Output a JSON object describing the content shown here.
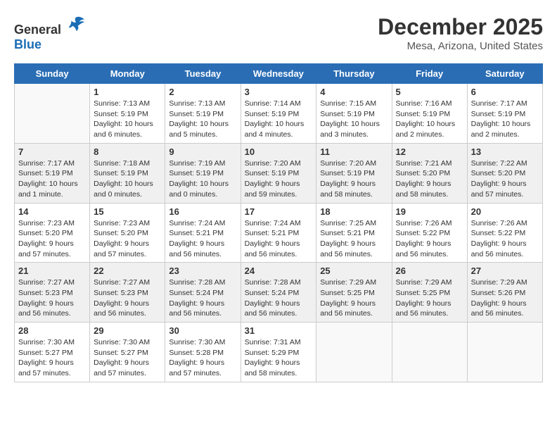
{
  "header": {
    "logo_general": "General",
    "logo_blue": "Blue",
    "title": "December 2025",
    "subtitle": "Mesa, Arizona, United States"
  },
  "calendar": {
    "days_of_week": [
      "Sunday",
      "Monday",
      "Tuesday",
      "Wednesday",
      "Thursday",
      "Friday",
      "Saturday"
    ],
    "weeks": [
      [
        {
          "day": "",
          "info": ""
        },
        {
          "day": "1",
          "info": "Sunrise: 7:13 AM\nSunset: 5:19 PM\nDaylight: 10 hours\nand 6 minutes."
        },
        {
          "day": "2",
          "info": "Sunrise: 7:13 AM\nSunset: 5:19 PM\nDaylight: 10 hours\nand 5 minutes."
        },
        {
          "day": "3",
          "info": "Sunrise: 7:14 AM\nSunset: 5:19 PM\nDaylight: 10 hours\nand 4 minutes."
        },
        {
          "day": "4",
          "info": "Sunrise: 7:15 AM\nSunset: 5:19 PM\nDaylight: 10 hours\nand 3 minutes."
        },
        {
          "day": "5",
          "info": "Sunrise: 7:16 AM\nSunset: 5:19 PM\nDaylight: 10 hours\nand 2 minutes."
        },
        {
          "day": "6",
          "info": "Sunrise: 7:17 AM\nSunset: 5:19 PM\nDaylight: 10 hours\nand 2 minutes."
        }
      ],
      [
        {
          "day": "7",
          "info": "Sunrise: 7:17 AM\nSunset: 5:19 PM\nDaylight: 10 hours\nand 1 minute."
        },
        {
          "day": "8",
          "info": "Sunrise: 7:18 AM\nSunset: 5:19 PM\nDaylight: 10 hours\nand 0 minutes."
        },
        {
          "day": "9",
          "info": "Sunrise: 7:19 AM\nSunset: 5:19 PM\nDaylight: 10 hours\nand 0 minutes."
        },
        {
          "day": "10",
          "info": "Sunrise: 7:20 AM\nSunset: 5:19 PM\nDaylight: 9 hours\nand 59 minutes."
        },
        {
          "day": "11",
          "info": "Sunrise: 7:20 AM\nSunset: 5:19 PM\nDaylight: 9 hours\nand 58 minutes."
        },
        {
          "day": "12",
          "info": "Sunrise: 7:21 AM\nSunset: 5:20 PM\nDaylight: 9 hours\nand 58 minutes."
        },
        {
          "day": "13",
          "info": "Sunrise: 7:22 AM\nSunset: 5:20 PM\nDaylight: 9 hours\nand 57 minutes."
        }
      ],
      [
        {
          "day": "14",
          "info": "Sunrise: 7:23 AM\nSunset: 5:20 PM\nDaylight: 9 hours\nand 57 minutes."
        },
        {
          "day": "15",
          "info": "Sunrise: 7:23 AM\nSunset: 5:20 PM\nDaylight: 9 hours\nand 57 minutes."
        },
        {
          "day": "16",
          "info": "Sunrise: 7:24 AM\nSunset: 5:21 PM\nDaylight: 9 hours\nand 56 minutes."
        },
        {
          "day": "17",
          "info": "Sunrise: 7:24 AM\nSunset: 5:21 PM\nDaylight: 9 hours\nand 56 minutes."
        },
        {
          "day": "18",
          "info": "Sunrise: 7:25 AM\nSunset: 5:21 PM\nDaylight: 9 hours\nand 56 minutes."
        },
        {
          "day": "19",
          "info": "Sunrise: 7:26 AM\nSunset: 5:22 PM\nDaylight: 9 hours\nand 56 minutes."
        },
        {
          "day": "20",
          "info": "Sunrise: 7:26 AM\nSunset: 5:22 PM\nDaylight: 9 hours\nand 56 minutes."
        }
      ],
      [
        {
          "day": "21",
          "info": "Sunrise: 7:27 AM\nSunset: 5:23 PM\nDaylight: 9 hours\nand 56 minutes."
        },
        {
          "day": "22",
          "info": "Sunrise: 7:27 AM\nSunset: 5:23 PM\nDaylight: 9 hours\nand 56 minutes."
        },
        {
          "day": "23",
          "info": "Sunrise: 7:28 AM\nSunset: 5:24 PM\nDaylight: 9 hours\nand 56 minutes."
        },
        {
          "day": "24",
          "info": "Sunrise: 7:28 AM\nSunset: 5:24 PM\nDaylight: 9 hours\nand 56 minutes."
        },
        {
          "day": "25",
          "info": "Sunrise: 7:29 AM\nSunset: 5:25 PM\nDaylight: 9 hours\nand 56 minutes."
        },
        {
          "day": "26",
          "info": "Sunrise: 7:29 AM\nSunset: 5:25 PM\nDaylight: 9 hours\nand 56 minutes."
        },
        {
          "day": "27",
          "info": "Sunrise: 7:29 AM\nSunset: 5:26 PM\nDaylight: 9 hours\nand 56 minutes."
        }
      ],
      [
        {
          "day": "28",
          "info": "Sunrise: 7:30 AM\nSunset: 5:27 PM\nDaylight: 9 hours\nand 57 minutes."
        },
        {
          "day": "29",
          "info": "Sunrise: 7:30 AM\nSunset: 5:27 PM\nDaylight: 9 hours\nand 57 minutes."
        },
        {
          "day": "30",
          "info": "Sunrise: 7:30 AM\nSunset: 5:28 PM\nDaylight: 9 hours\nand 57 minutes."
        },
        {
          "day": "31",
          "info": "Sunrise: 7:31 AM\nSunset: 5:29 PM\nDaylight: 9 hours\nand 58 minutes."
        },
        {
          "day": "",
          "info": ""
        },
        {
          "day": "",
          "info": ""
        },
        {
          "day": "",
          "info": ""
        }
      ]
    ]
  }
}
